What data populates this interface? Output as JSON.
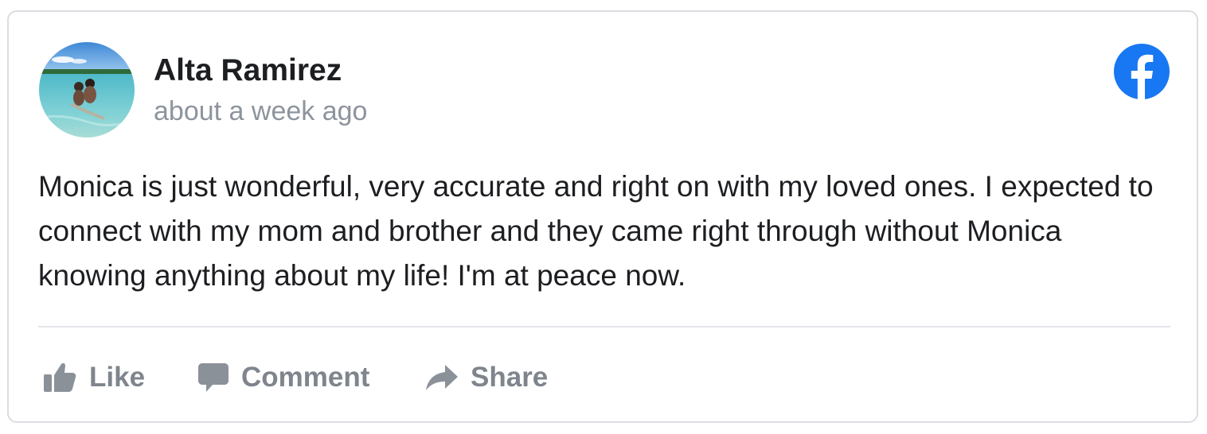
{
  "post": {
    "author": "Alta Ramirez",
    "timestamp": "about a week ago",
    "text": "Monica is just wonderful, very accurate and right on with my loved ones. I expected to connect with my mom and brother and they came right through without Monica knowing anything about my life! I'm at peace now."
  },
  "brand": {
    "icon": "facebook-logo-icon",
    "color": "#1877f2"
  },
  "actions": {
    "like": {
      "label": "Like",
      "icon": "thumbs-up-icon"
    },
    "comment": {
      "label": "Comment",
      "icon": "speech-bubble-icon"
    },
    "share": {
      "label": "Share",
      "icon": "share-arrow-icon"
    }
  },
  "colors": {
    "text": "#1c1e21",
    "muted": "#8d949e",
    "action": "#7f858d",
    "border": "#dadde1"
  }
}
